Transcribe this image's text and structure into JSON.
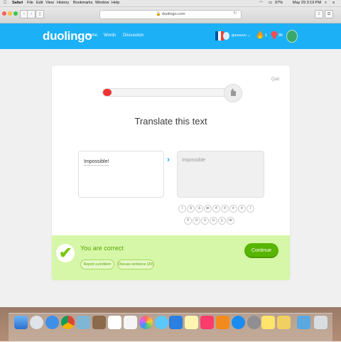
{
  "menubar": {
    "app": "Safari",
    "items": [
      "File",
      "Edit",
      "View",
      "History",
      "Bookmarks",
      "Window",
      "Help"
    ],
    "battery": "97%",
    "clock": "May 29  3:19 PM"
  },
  "browser": {
    "url": "duolingo.com"
  },
  "header": {
    "logo": "duolingo",
    "nav": [
      "Home",
      "Words",
      "Discussion"
    ],
    "username": "guusuvu",
    "streak": "1",
    "gems": "86"
  },
  "lesson": {
    "quit": "Quit",
    "progress": 0.07,
    "title": "Translate this text",
    "prompt": "Impossible!",
    "answer": "impossible",
    "special_chars_row1": [
      "î",
      "â",
      "à",
      "æ",
      "ê",
      "è",
      "é",
      "ë",
      "ï"
    ],
    "special_chars_row2": [
      "ô",
      "û",
      "ù",
      "ü",
      "ç",
      "œ"
    ],
    "result_text": "You are correct",
    "report_label": "Report a problem",
    "discuss_label": "Discuss sentence (20)",
    "continue_label": "Continue"
  },
  "colors": {
    "brand_blue": "#1cb0f6",
    "success_green": "#58b500",
    "result_bg": "#d6f6a8"
  }
}
